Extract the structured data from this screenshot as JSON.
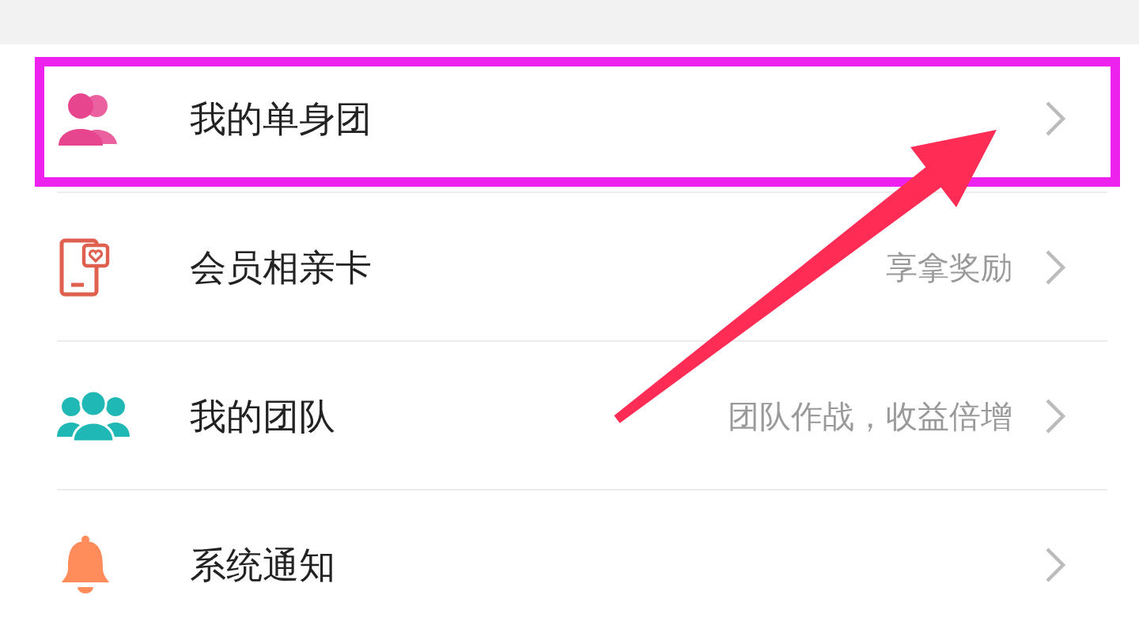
{
  "menu": [
    {
      "label": "我的单身团",
      "highlighted": true
    },
    {
      "label": "会员相亲卡",
      "hint": "享拿奖励",
      "highlighted": false
    },
    {
      "label": "我的团队",
      "hint": "团队作战，收益倍增",
      "highlighted": false
    },
    {
      "label": "系统通知",
      "highlighted": false
    }
  ]
}
